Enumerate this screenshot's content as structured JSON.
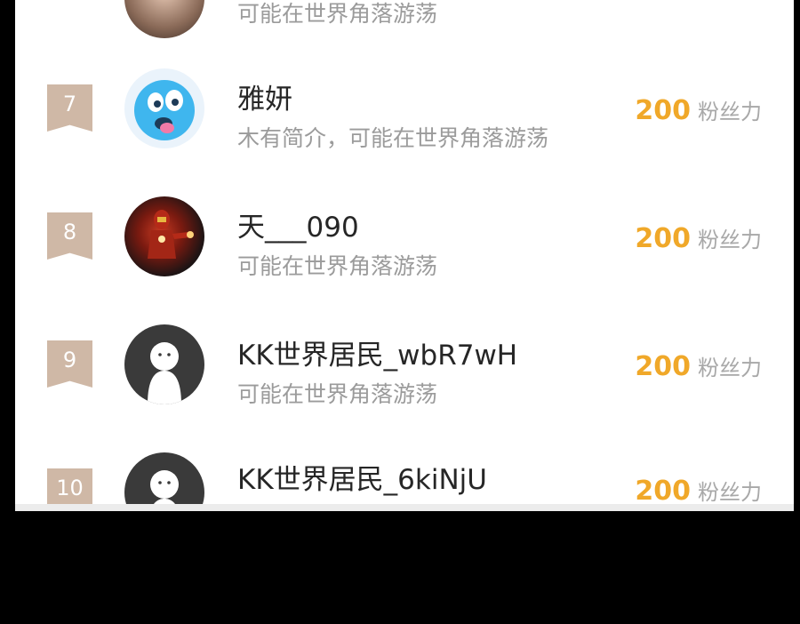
{
  "ranking": {
    "rows": [
      {
        "rank": "",
        "name": "",
        "desc": "可能在世界角落游荡",
        "score": "",
        "unit": "",
        "avatar": "photo-avatar"
      },
      {
        "rank": "7",
        "name": "雅妍",
        "desc": "木有简介，可能在世界角落游荡",
        "score": "200",
        "unit": "粉丝力",
        "avatar": "emoji-avatar"
      },
      {
        "rank": "8",
        "name": "天___090",
        "desc": "可能在世界角落游荡",
        "score": "200",
        "unit": "粉丝力",
        "avatar": "iron-man-avatar"
      },
      {
        "rank": "9",
        "name": "KK世界居民_wbR7wH",
        "desc": "可能在世界角落游荡",
        "score": "200",
        "unit": "粉丝力",
        "avatar": "default-avatar"
      },
      {
        "rank": "10",
        "name": "KK世界居民_6kiNjU",
        "desc": "",
        "score": "200",
        "unit": "粉丝力",
        "avatar": "default-avatar"
      }
    ]
  }
}
